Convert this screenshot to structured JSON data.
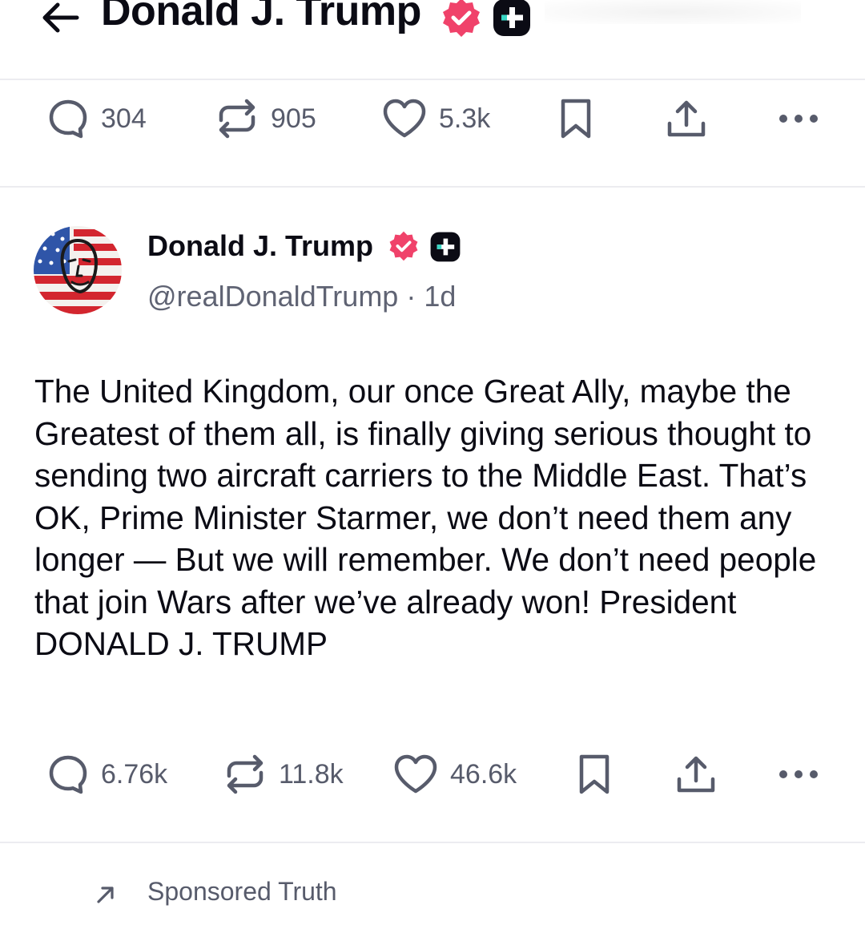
{
  "header": {
    "title": "Donald J. Trump",
    "back_icon": "arrow-left-icon",
    "verified_icon": "verified-badge-icon",
    "plus_icon": "truth-plus-icon"
  },
  "top_actions": {
    "replies": "304",
    "retruths": "905",
    "likes": "5.3k"
  },
  "post": {
    "author_name": "Donald J. Trump",
    "handle": "@realDonaldTrump",
    "time": "· 1d",
    "text": "The United Kingdom, our once Great Ally, maybe the Greatest of them all, is finally giving serious thought to sending two aircraft carriers to the Middle East. That’s OK, Prime Minister Starmer, we don’t need them any longer — But we will remember. We don’t need people that join Wars after we’ve already won! President DONALD J. TRUMP",
    "replies": "6.76k",
    "retruths": "11.8k",
    "likes": "46.6k"
  },
  "sponsored": {
    "label": "Sponsored Truth",
    "icon": "arrow-up-right-icon"
  },
  "colors": {
    "verified": "#f0426a",
    "plus_badge": "#0b0b14",
    "plus_accent": "#38d6c4",
    "text_secondary": "#575b6b",
    "icon": "#575b6b",
    "divider": "#ececf0"
  }
}
